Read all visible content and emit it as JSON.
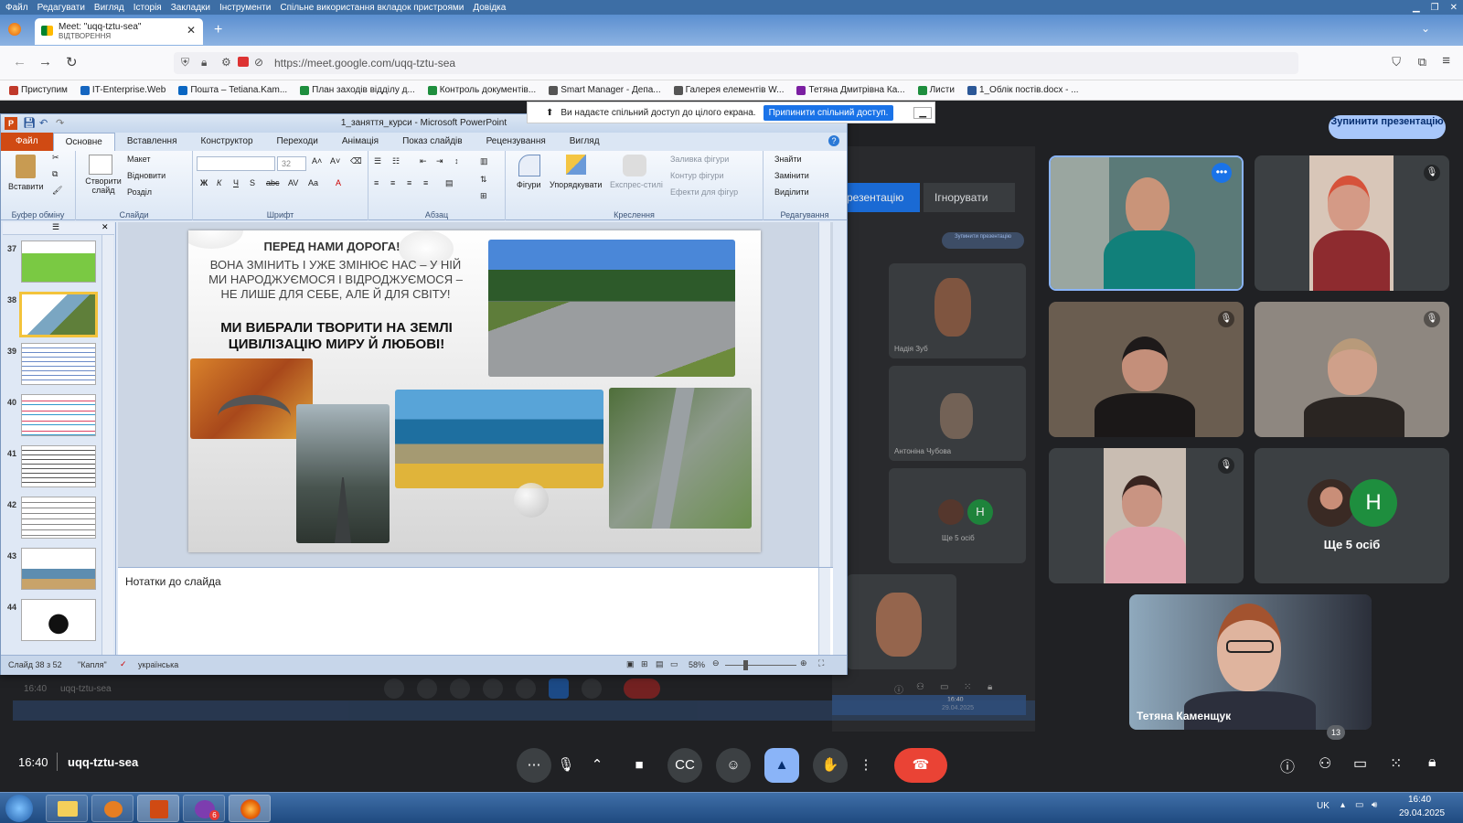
{
  "firefox": {
    "menu": [
      "Файл",
      "Редагувати",
      "Вигляд",
      "Історія",
      "Закладки",
      "Інструменти",
      "Спільне використання вкладок пристроями",
      "Довідка"
    ],
    "tab_title": "Meet: \"uqq-tztu-sea\"",
    "tab_subtitle": "ВІДТВОРЕННЯ",
    "url": "https://meet.google.com/uqq-tztu-sea",
    "bookmarks": [
      "Приступим",
      "IT-Enterprise.Web",
      "Пошта – Tetiana.Kam...",
      "План заходів відділу д...",
      "Контроль документів...",
      "Smart Manager - Депа...",
      "Галерея елементів W...",
      "Тетяна Дмитрівна Ка...",
      "Листи",
      "1_Облік постів.docx - ..."
    ],
    "bookmark_colors": [
      "#c0392b",
      "#1565c0",
      "#0a66c2",
      "#1e8e3e",
      "#1e8e3e",
      "#555555",
      "#555555",
      "#7b1fa2",
      "#1e8e3e",
      "#2b5797"
    ]
  },
  "share_bar": {
    "text": "Ви надаєте спільний доступ до цілого екрана.",
    "stop": "Припинити спільний доступ."
  },
  "powerpoint": {
    "title": "1_заняття_курси - Microsoft PowerPoint",
    "tabs": [
      "Файл",
      "Основне",
      "Вставлення",
      "Конструктор",
      "Переходи",
      "Анімація",
      "Показ слайдів",
      "Рецензування",
      "Вигляд"
    ],
    "active_tab": "Основне",
    "ribbon": {
      "paste": "Вставити",
      "clipboard": "Буфер обміну",
      "new_slide": "Створити слайд",
      "layout": "Макет",
      "reset": "Відновити",
      "section": "Розділ",
      "slides": "Слайди",
      "font_size": "32",
      "font": "Шрифт",
      "paragraph": "Абзац",
      "shapes": "Фігури",
      "arrange": "Упорядкувати",
      "quick_styles": "Експрес-стилі",
      "shape_fill": "Заливка фігури",
      "shape_outline": "Контур фігури",
      "shape_effects": "Ефекти для фігур",
      "drawing": "Креслення",
      "find": "Знайти",
      "replace": "Замінити",
      "select": "Виділити",
      "editing": "Редагування"
    },
    "thumb_numbers": [
      "37",
      "38",
      "39",
      "40",
      "41",
      "42",
      "43",
      "44"
    ],
    "selected_thumb": "38",
    "slide": {
      "title": "ПЕРЕД НАМИ ДОРОГА!",
      "para": "ВОНА ЗМІНИТЬ І УЖЕ ЗМІНЮЄ НАС – У НІЙ МИ НАРОДЖУЄМОСЯ І ВІДРОДЖУЄМОСЯ –НЕ ЛИШЕ ДЛЯ СЕБЕ, АЛЕ Й ДЛЯ СВІТУ!",
      "bold": "МИ ВИБРАЛИ ТВОРИТИ НА ЗЕМЛІ ЦИВІЛІЗАЦІЮ МИРУ Й ЛЮБОВІ!"
    },
    "notes": "Нотатки до слайда",
    "status": {
      "slide": "Слайд 38 з 52",
      "theme": "\"Капля\"",
      "lang": "українська",
      "zoom": "58%"
    }
  },
  "meet": {
    "stop_present": "Зупинити презентацію",
    "ghost_present": "резентацію",
    "ghost_ignore": "Ігнорувати",
    "ghost_stop": "Зупинити презентацію",
    "ghost_names": [
      "Надія Зуб",
      "Антоніна Чубова",
      "Ще 5 осіб"
    ],
    "ghost_time": "16:40",
    "ghost_code": "uqq-tztu-sea",
    "ghost_date": "29.04.2025",
    "more_label": "Ще 5 осіб",
    "more_initial": "Н",
    "featured_name": "Тетяна Каменщук",
    "time": "16:40",
    "code": "uqq-tztu-sea",
    "participants_count": "13"
  },
  "taskbar": {
    "lang": "UK",
    "time": "16:40",
    "date": "29.04.2025",
    "viber_badge": "6"
  }
}
